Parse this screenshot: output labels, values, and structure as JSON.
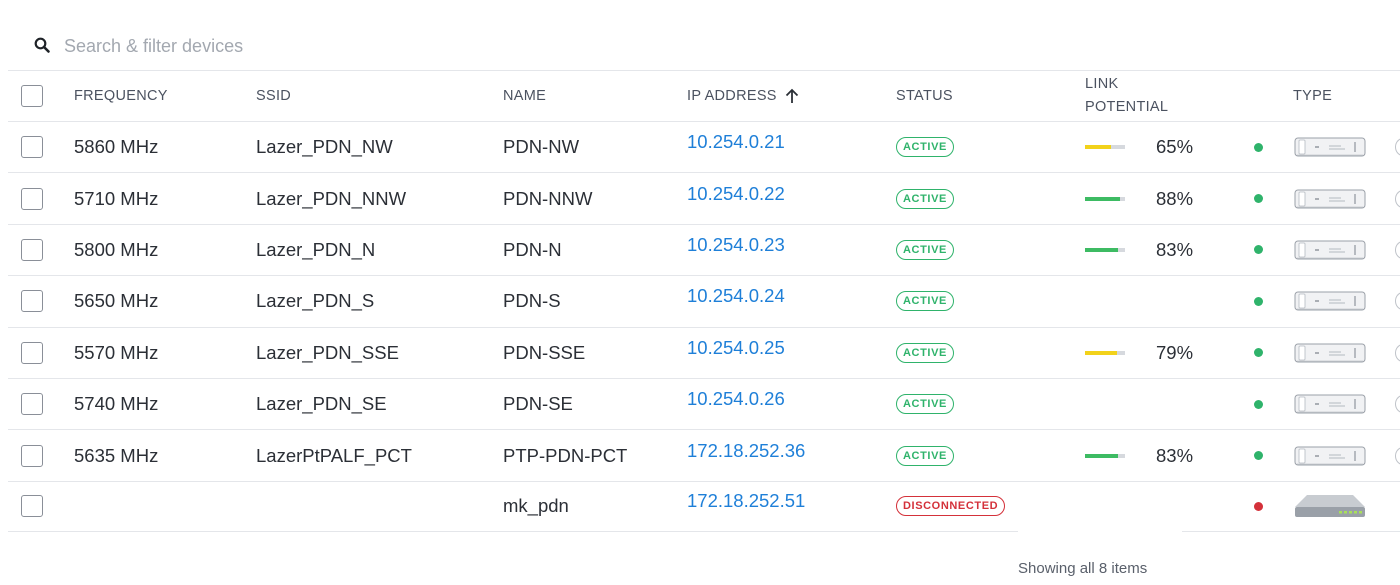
{
  "search": {
    "placeholder": "Search & filter devices"
  },
  "columns": {
    "frequency": "FREQUENCY",
    "ssid": "SSID",
    "name": "NAME",
    "ip": "IP ADDRESS",
    "status": "STATUS",
    "link_line1": "LINK",
    "link_line2": "POTENTIAL",
    "type": "TYPE"
  },
  "sort": {
    "column": "ip",
    "direction": "ascending",
    "icon": "arrow-up-icon"
  },
  "colors": {
    "active": "#2fb36b",
    "disconnected": "#d4313a",
    "link": "#1e7fd8",
    "bar_green": "#3dbb63",
    "bar_yellow": "#f2d21a"
  },
  "rows": [
    {
      "frequency": "5860 MHz",
      "ssid": "Lazer_PDN_NW",
      "name": "PDN-NW",
      "ip": "10.254.0.21",
      "status": "ACTIVE",
      "link_potential": 65,
      "link_label": "65%",
      "link_color": "#f2d21a",
      "online": true,
      "device_icon": "radio-antenna-icon"
    },
    {
      "frequency": "5710 MHz",
      "ssid": "Lazer_PDN_NNW",
      "name": "PDN-NNW",
      "ip": "10.254.0.22",
      "status": "ACTIVE",
      "link_potential": 88,
      "link_label": "88%",
      "link_color": "#3dbb63",
      "online": true,
      "device_icon": "radio-antenna-icon"
    },
    {
      "frequency": "5800 MHz",
      "ssid": "Lazer_PDN_N",
      "name": "PDN-N",
      "ip": "10.254.0.23",
      "status": "ACTIVE",
      "link_potential": 83,
      "link_label": "83%",
      "link_color": "#3dbb63",
      "online": true,
      "device_icon": "radio-antenna-icon"
    },
    {
      "frequency": "5650 MHz",
      "ssid": "Lazer_PDN_S",
      "name": "PDN-S",
      "ip": "10.254.0.24",
      "status": "ACTIVE",
      "link_potential": null,
      "link_label": "",
      "link_color": "",
      "online": true,
      "device_icon": "radio-antenna-icon"
    },
    {
      "frequency": "5570 MHz",
      "ssid": "Lazer_PDN_SSE",
      "name": "PDN-SSE",
      "ip": "10.254.0.25",
      "status": "ACTIVE",
      "link_potential": 79,
      "link_label": "79%",
      "link_color": "#f2d21a",
      "online": true,
      "device_icon": "radio-antenna-icon"
    },
    {
      "frequency": "5740 MHz",
      "ssid": "Lazer_PDN_SE",
      "name": "PDN-SE",
      "ip": "10.254.0.26",
      "status": "ACTIVE",
      "link_potential": null,
      "link_label": "",
      "link_color": "",
      "online": true,
      "device_icon": "radio-antenna-icon"
    },
    {
      "frequency": "5635 MHz",
      "ssid": "LazerPtPALF_PCT",
      "name": "PTP-PDN-PCT",
      "ip": "172.18.252.36",
      "status": "ACTIVE",
      "link_potential": 83,
      "link_label": "83%",
      "link_color": "#3dbb63",
      "online": true,
      "device_icon": "radio-antenna-icon"
    },
    {
      "frequency": "",
      "ssid": "",
      "name": "mk_pdn",
      "ip": "172.18.252.51",
      "status": "DISCONNECTED",
      "link_potential": null,
      "link_label": "",
      "link_color": "",
      "online": false,
      "device_icon": "router-icon"
    }
  ],
  "footer": {
    "summary": "Showing all 8 items"
  }
}
